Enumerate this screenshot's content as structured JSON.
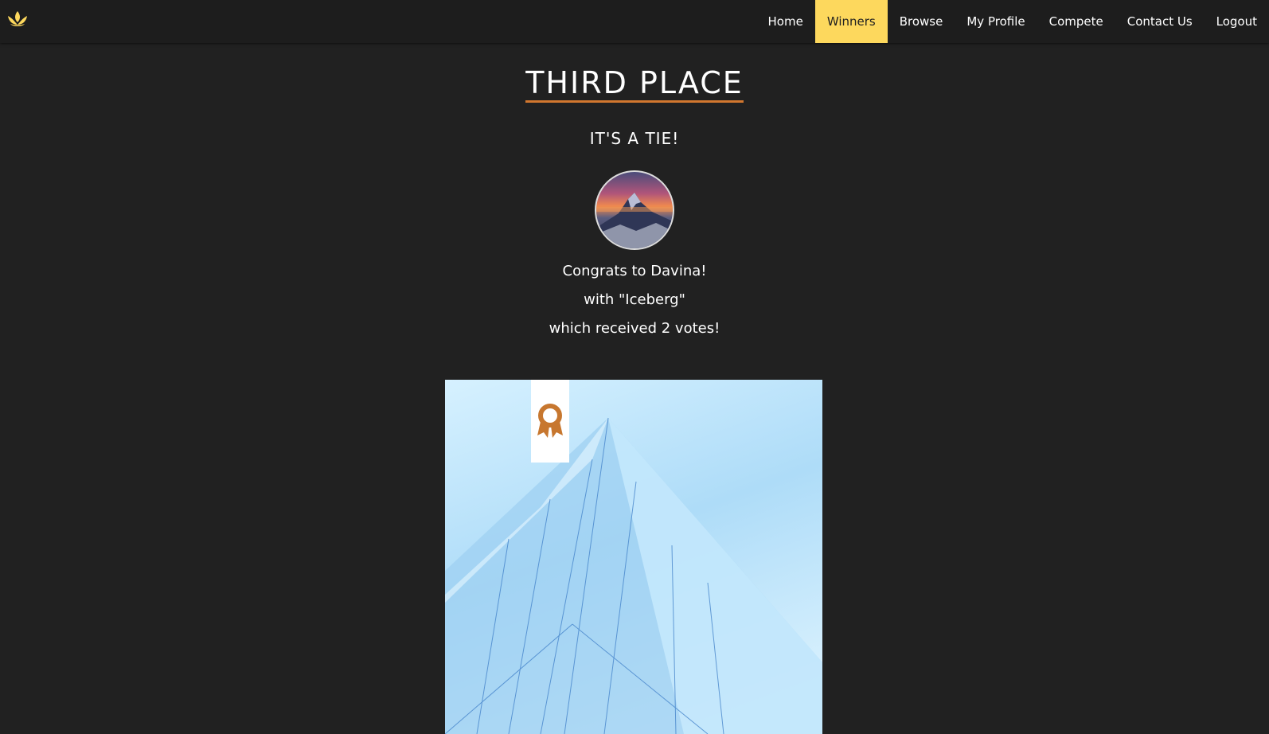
{
  "nav": {
    "logo_icon": "lotus-icon",
    "items": [
      {
        "label": "Home",
        "active": false
      },
      {
        "label": "Winners",
        "active": true
      },
      {
        "label": "Browse",
        "active": false
      },
      {
        "label": "My Profile",
        "active": false
      },
      {
        "label": "Compete",
        "active": false
      },
      {
        "label": "Contact Us",
        "active": false
      },
      {
        "label": "Logout",
        "active": false
      }
    ]
  },
  "colors": {
    "background": "#212121",
    "navbar": "#1d1d1d",
    "accent_active": "#fdd85d",
    "underline": "#d2772f",
    "badge": "#c7772f"
  },
  "winner": {
    "title": "THIRD PLACE",
    "subtitle": "IT'S A TIE!",
    "congrats": "Congrats to Davina!",
    "entry": "with \"Iceberg\"",
    "votes": "which received 2 votes!",
    "badge_icon": "award-ribbon-icon"
  }
}
